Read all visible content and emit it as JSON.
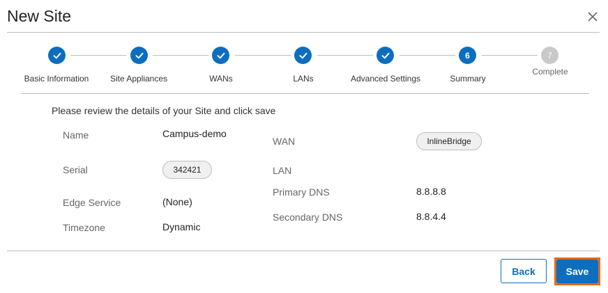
{
  "dialog": {
    "title": "New Site",
    "intro": "Please review the details of your Site and click save"
  },
  "steps": [
    {
      "label": "Basic Information",
      "status": "done",
      "number": ""
    },
    {
      "label": "Site Appliances",
      "status": "done",
      "number": ""
    },
    {
      "label": "WANs",
      "status": "done",
      "number": ""
    },
    {
      "label": "LANs",
      "status": "done",
      "number": ""
    },
    {
      "label": "Advanced Settings",
      "status": "done",
      "number": ""
    },
    {
      "label": "Summary",
      "status": "current",
      "number": "6"
    },
    {
      "label": "Complete",
      "status": "pending",
      "number": "7"
    }
  ],
  "summary": {
    "name_label": "Name",
    "name_value": "Campus-demo",
    "serial_label": "Serial",
    "serial_value": "342421",
    "edge_label": "Edge Service",
    "edge_value": "(None)",
    "timezone_label": "Timezone",
    "timezone_value": "Dynamic",
    "wan_label": "WAN",
    "wan_value": "InlineBridge",
    "lan_label": "LAN",
    "primary_dns_label": "Primary DNS",
    "primary_dns_value": "8.8.8.8",
    "secondary_dns_label": "Secondary DNS",
    "secondary_dns_value": "8.8.4.4"
  },
  "footer": {
    "back_label": "Back",
    "save_label": "Save"
  },
  "colors": {
    "accent": "#0d6ebf",
    "focus_outline": "#e06a1c",
    "pending_step": "#c9c9c9"
  },
  "icons": {
    "close": "close-icon",
    "step_done": "check-icon"
  }
}
